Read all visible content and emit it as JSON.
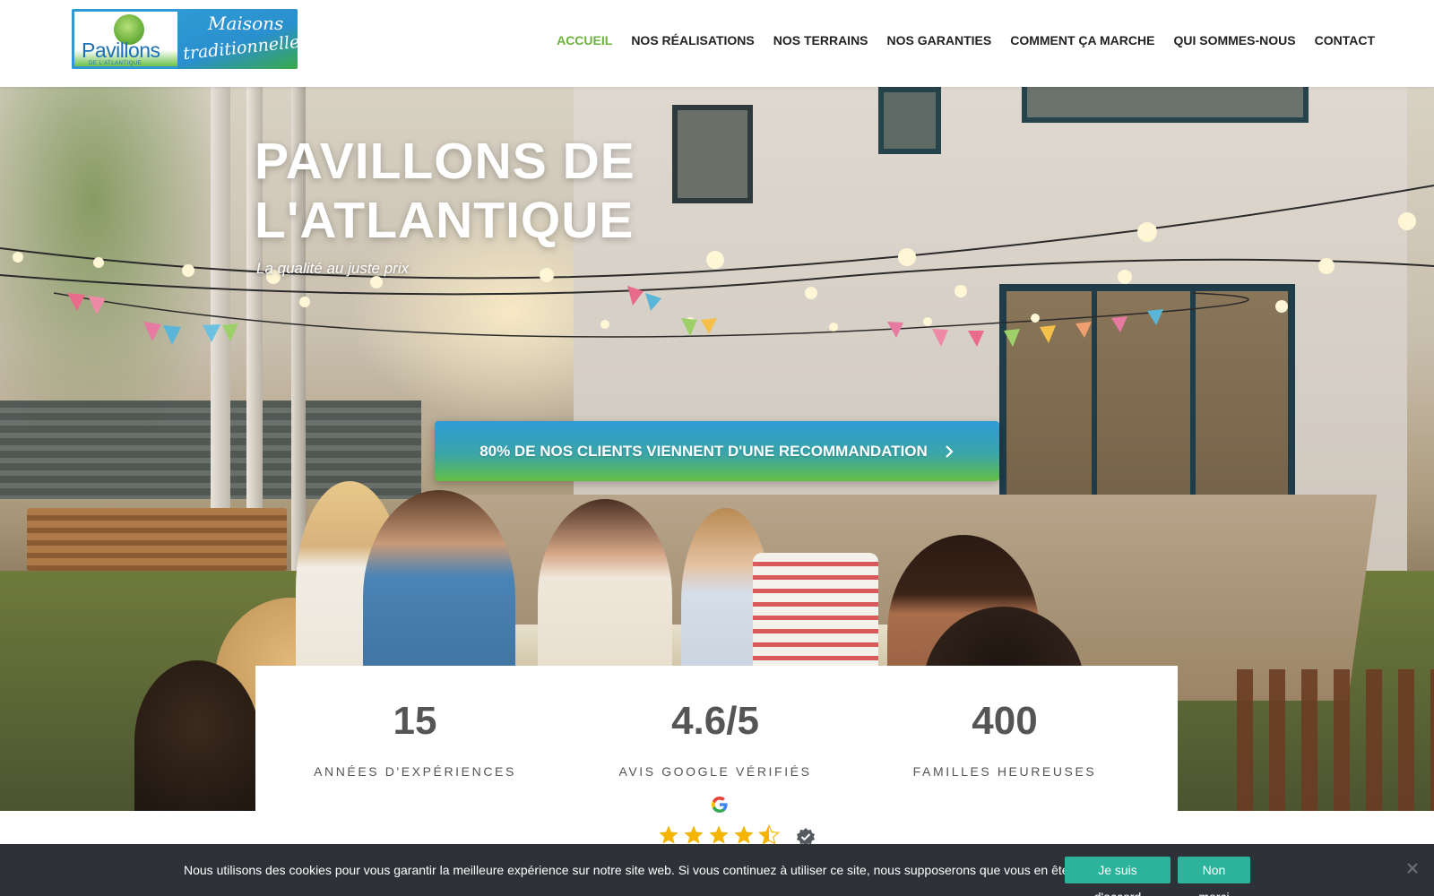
{
  "header": {
    "logo": {
      "name": "Pavillons",
      "subtitle": "DE L'ATLANTIQUE",
      "tagline_line1": "Maisons",
      "tagline_line2": "traditionnelles"
    },
    "nav": [
      {
        "label": "ACCUEIL",
        "active": true
      },
      {
        "label": "NOS RÉALISATIONS",
        "active": false
      },
      {
        "label": "NOS TERRAINS",
        "active": false
      },
      {
        "label": "NOS GARANTIES",
        "active": false
      },
      {
        "label": "COMMENT ÇA MARCHE",
        "active": false
      },
      {
        "label": "QUI SOMMES-NOUS",
        "active": false
      },
      {
        "label": "CONTACT",
        "active": false
      }
    ]
  },
  "hero": {
    "title_line1": "PAVILLONS DE",
    "title_line2": "L'ATLANTIQUE",
    "subtitle": "La qualité au juste prix",
    "cta_label": "80% DE NOS CLIENTS VIENNENT D'UNE RECOMMANDATION",
    "cta_icon": "chevron-right-icon"
  },
  "stats": [
    {
      "value": "15",
      "label": "ANNÉES D'EXPÉRIENCES"
    },
    {
      "value": "4.6/5",
      "label": "AVIS GOOGLE VÉRIFIÉS"
    },
    {
      "value": "400",
      "label": "FAMILLES HEUREUSES"
    }
  ],
  "rating": {
    "stars": 4.5,
    "max_stars": 5,
    "source_icon": "google-g-icon",
    "badge_icon": "verified-check-icon"
  },
  "cookie_bar": {
    "text": "Nous utilisons des cookies pour vous garantir la meilleure expérience sur notre site web. Si vous continuez à utiliser ce site, nous supposerons que vous en êtes satisfait.",
    "accept_label": "Je suis d'accord",
    "decline_label": "Non merci",
    "close_icon": "close-icon"
  },
  "colors": {
    "nav_active": "#6cb23c",
    "nav_text": "#222222",
    "cta_top": "#2f9bd6",
    "cta_bottom": "#64be45",
    "stat_text": "#555555",
    "cookie_bg": "#2e3238",
    "cookie_button": "#2bb39b",
    "star": "#f4b400"
  }
}
